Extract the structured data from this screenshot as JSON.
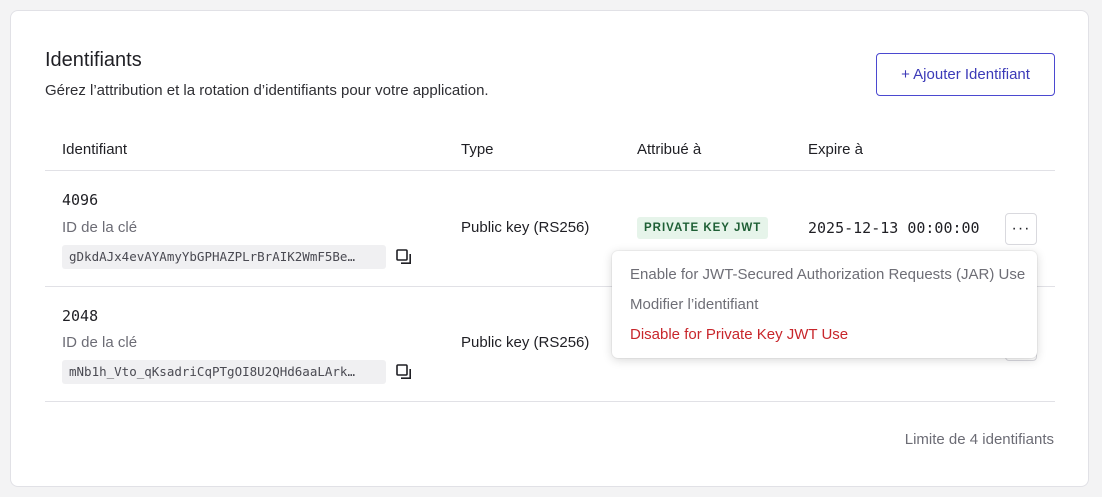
{
  "header": {
    "title": "Identifiants",
    "subtitle": "Gérez l’attribution et la rotation d’identifiants pour votre application.",
    "add_button": "+ Ajouter Identifiant"
  },
  "table": {
    "columns": [
      "Identifiant",
      "Type",
      "Attribué à",
      "Expire à"
    ],
    "rows": [
      {
        "bits": "4096",
        "key_label": "ID de la clé",
        "key_id": "gDkdAJx4evAYAmyYbGPHAZPLrBrAIK2WmF5Be…",
        "type": "Public key (RS256)",
        "assigned": "PRIVATE KEY JWT",
        "expires": "2025-12-13 00:00:00"
      },
      {
        "bits": "2048",
        "key_label": "ID de la clé",
        "key_id": "mNb1h_Vto_qKsadriCqPTgOI8U2QHd6aaLArk…",
        "type": "Public key (RS256)",
        "assigned": "",
        "expires": ""
      }
    ]
  },
  "row_menu": {
    "items": [
      "Enable for JWT-Secured Authorization Requests (JAR) Use",
      "Modifier l’identifiant",
      "Disable for Private Key JWT Use"
    ],
    "more_label": "···"
  },
  "footer": {
    "limit_text": "Limite de 4 identifiants"
  },
  "colors": {
    "accent": "#3c3ab8",
    "badge_bg": "#e6f4ea",
    "badge_fg": "#1e5f35",
    "danger": "#c8262b"
  },
  "icons": {
    "copy": "copy-icon",
    "more": "more-horizontal-icon"
  }
}
